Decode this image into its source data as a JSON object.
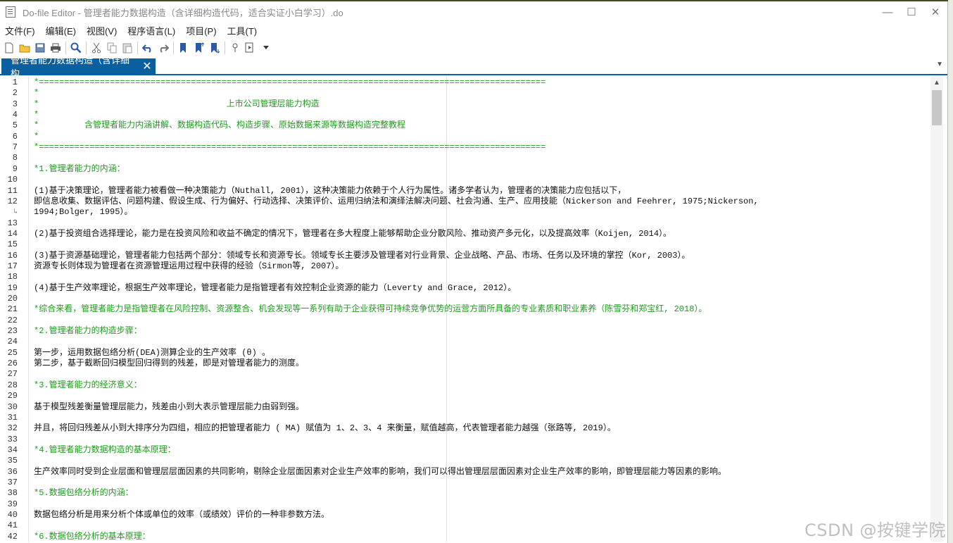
{
  "window": {
    "title": "Do-file Editor - 管理者能力数据构造（含详细构造代码，适合实证小白学习）.do"
  },
  "menu": [
    "文件(F)",
    "编辑(E)",
    "视图(V)",
    "程序语言(L)",
    "项目(P)",
    "工具(T)"
  ],
  "tab": {
    "label": "管理者能力数据构造（含详细构..."
  },
  "editor": {
    "lines": [
      {
        "n": "1",
        "t": "*====================================================================================================",
        "c": true
      },
      {
        "n": "2",
        "t": "*",
        "c": true
      },
      {
        "n": "3",
        "t": "*                                     上市公司管理层能力构造",
        "c": true
      },
      {
        "n": "4",
        "t": "*",
        "c": true
      },
      {
        "n": "5",
        "t": "*         含管理者能力内涵讲解、数据构造代码、构造步骤、原始数据来源等数据构造完整教程",
        "c": true
      },
      {
        "n": "6",
        "t": "*",
        "c": true
      },
      {
        "n": "7",
        "t": "*====================================================================================================",
        "c": true
      },
      {
        "n": "8",
        "t": "",
        "c": false
      },
      {
        "n": "9",
        "t": "*1.管理者能力的内涵：",
        "c": true
      },
      {
        "n": "10",
        "t": "",
        "c": false
      },
      {
        "n": "11",
        "t": "(1)基于决策理论，管理者能力被看做一种决策能力（Nuthall, 2001），这种决策能力依赖于个人行为属性。诸多学者认为，管理者的决策能力应包括以下，",
        "c": false
      },
      {
        "n": "12",
        "t": "即信息收集、数据评估、问题构建、假设生成、行为偏好、行动选择、决策评价、运用归纳法和演绎法解决问题、社会沟通、生产、应用技能（Nickerson and Feehrer, 1975;Nickerson,",
        "c": false
      },
      {
        "n": "↳",
        "t": "1994;Bolger, 1995）。",
        "c": false,
        "w": true
      },
      {
        "n": "13",
        "t": "",
        "c": false
      },
      {
        "n": "14",
        "t": "(2)基于投资组合选择理论，能力是在投资风险和收益不确定的情况下，管理者在多大程度上能够帮助企业分散风险、推动资产多元化，以及提高效率（Koijen, 2014）。",
        "c": false
      },
      {
        "n": "15",
        "t": "",
        "c": false
      },
      {
        "n": "16",
        "t": "(3)基于资源基础理论，管理者能力包括两个部分：领域专长和资源专长。领域专长主要涉及管理者对行业背景、企业战略、产品、市场、任务以及环境的掌控（Kor, 2003）。",
        "c": false
      },
      {
        "n": "17",
        "t": "资源专长则体现为管理者在资源管理运用过程中获得的经验（Sirmon等, 2007）。",
        "c": false
      },
      {
        "n": "18",
        "t": "",
        "c": false
      },
      {
        "n": "19",
        "t": "(4)基于生产效率理论，根据生产效率理论，管理者能力是指管理者有效控制企业资源的能力（Leverty and Grace, 2012）。",
        "c": false
      },
      {
        "n": "20",
        "t": "",
        "c": false
      },
      {
        "n": "21",
        "t": "*综合来看，管理者能力是指管理者在风险控制、资源整合、机会发现等一系列有助于企业获得可持续竞争优势的运营方面所具备的专业素质和职业素养（陈雪芬和郑宝红, 2018）。",
        "c": true
      },
      {
        "n": "22",
        "t": "",
        "c": false
      },
      {
        "n": "23",
        "t": "*2.管理者能力的构造步骤：",
        "c": true
      },
      {
        "n": "24",
        "t": "",
        "c": false
      },
      {
        "n": "25",
        "t": "第一步，运用数据包络分析(DEA)测算企业的生产效率 (θ) 。",
        "c": false
      },
      {
        "n": "26",
        "t": "第二步，基于截断回归模型回归得到的残差，即是对管理者能力的测度。",
        "c": false
      },
      {
        "n": "27",
        "t": "",
        "c": false
      },
      {
        "n": "28",
        "t": "*3.管理者能力的经济意义：",
        "c": true
      },
      {
        "n": "29",
        "t": "",
        "c": false
      },
      {
        "n": "30",
        "t": "基于模型残差衡量管理层能力，残差由小到大表示管理层能力由弱到强。",
        "c": false
      },
      {
        "n": "31",
        "t": "",
        "c": false
      },
      {
        "n": "32",
        "t": "并且，将回归残差从小到大排序分为四组，相应的把管理者能力 ( MA) 赋值为 1、2、3、4 来衡量，赋值越高，代表管理者能力越强（张路等, 2019）。",
        "c": false
      },
      {
        "n": "33",
        "t": "",
        "c": false
      },
      {
        "n": "34",
        "t": "*4.管理者能力数据构造的基本原理：",
        "c": true
      },
      {
        "n": "35",
        "t": "",
        "c": false
      },
      {
        "n": "36",
        "t": "生产效率同时受到企业层面和管理层层面因素的共同影响，剔除企业层面因素对企业生产效率的影响，我们可以得出管理层层面因素对企业生产效率的影响，即管理层能力等因素的影响。",
        "c": false
      },
      {
        "n": "37",
        "t": "",
        "c": false
      },
      {
        "n": "38",
        "t": "*5.数据包络分析的内涵：",
        "c": true
      },
      {
        "n": "39",
        "t": "",
        "c": false
      },
      {
        "n": "40",
        "t": "数据包络分析是用来分析个体或单位的效率（或绩效）评价的一种非参数方法。",
        "c": false
      },
      {
        "n": "41",
        "t": "",
        "c": false
      },
      {
        "n": "42",
        "t": "*6.数据包络分析的基本原理：",
        "c": true
      }
    ]
  },
  "watermark": "CSDN @按键学院"
}
